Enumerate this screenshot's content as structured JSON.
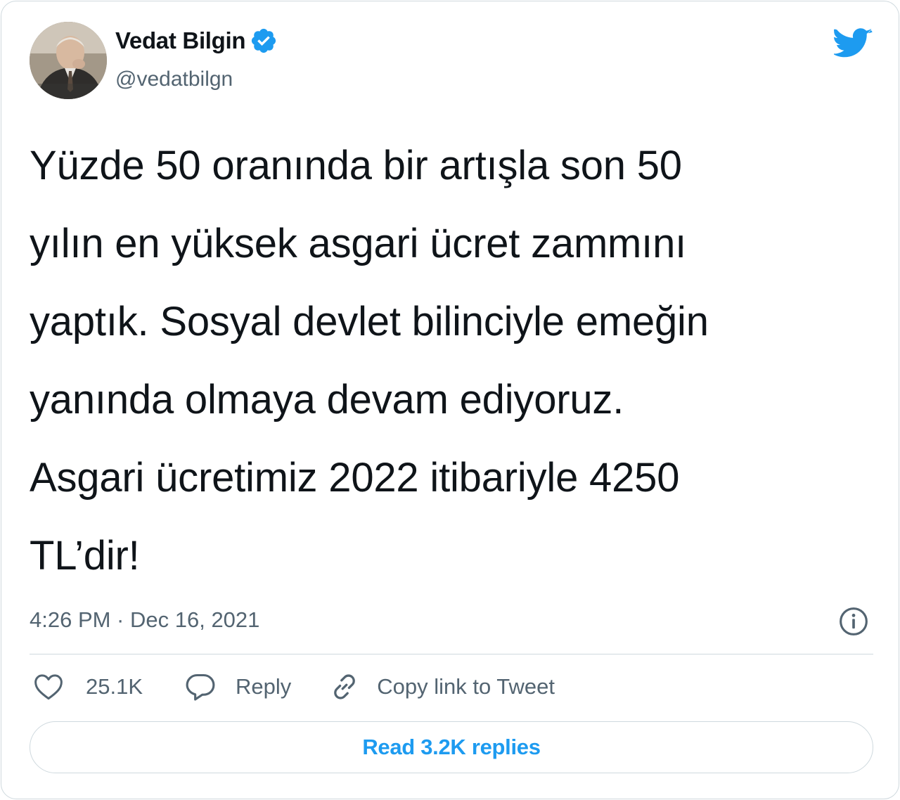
{
  "author": {
    "display_name": "Vedat Bilgin",
    "handle": "@vedatbilgn",
    "verified": true
  },
  "tweet": {
    "text": "Yüzde 50 oranında bir artışla son 50\nyılın en yüksek asgari ücret zammını\nyaptık. Sosyal devlet bilinciyle emeğin\nyanında olmaya devam ediyoruz.\nAsgari ücretimiz 2022 itibariyle 4250\nTL’dir!",
    "timestamp": "4:26 PM · Dec 16, 2021"
  },
  "actions": {
    "likes": "25.1K",
    "reply_label": "Reply",
    "copy_link_label": "Copy link to Tweet"
  },
  "read_replies_label": "Read 3.2K replies",
  "colors": {
    "brand_blue": "#1d9bf0",
    "secondary_text": "#536471",
    "border": "#cfd9de"
  },
  "icons": [
    "verified-badge-icon",
    "twitter-bird-icon",
    "info-icon",
    "heart-icon",
    "reply-bubble-icon",
    "link-icon"
  ]
}
